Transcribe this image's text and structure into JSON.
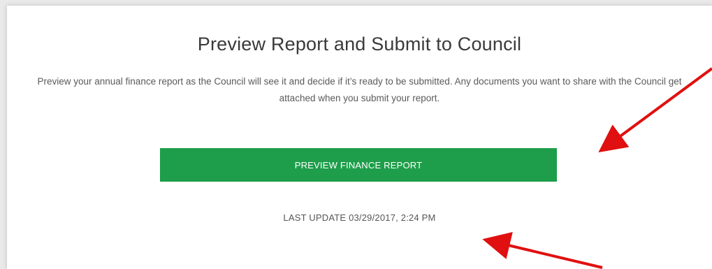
{
  "panel": {
    "title": "Preview Report and Submit to Council",
    "description": "Preview your annual finance report as the Council will see it and decide if it’s ready to be submitted. Any documents you want to share with the Council get attached when you submit your report.",
    "preview_button_label": "PREVIEW FINANCE REPORT",
    "last_update": "LAST UPDATE 03/29/2017, 2:24 PM"
  },
  "colors": {
    "button_bg": "#1e9e4a",
    "button_text": "#ffffff",
    "annotation_arrow": "#e01010"
  },
  "annotations": {
    "arrows": [
      "arrow-pointing-to-preview-button",
      "arrow-pointing-to-last-update"
    ]
  }
}
